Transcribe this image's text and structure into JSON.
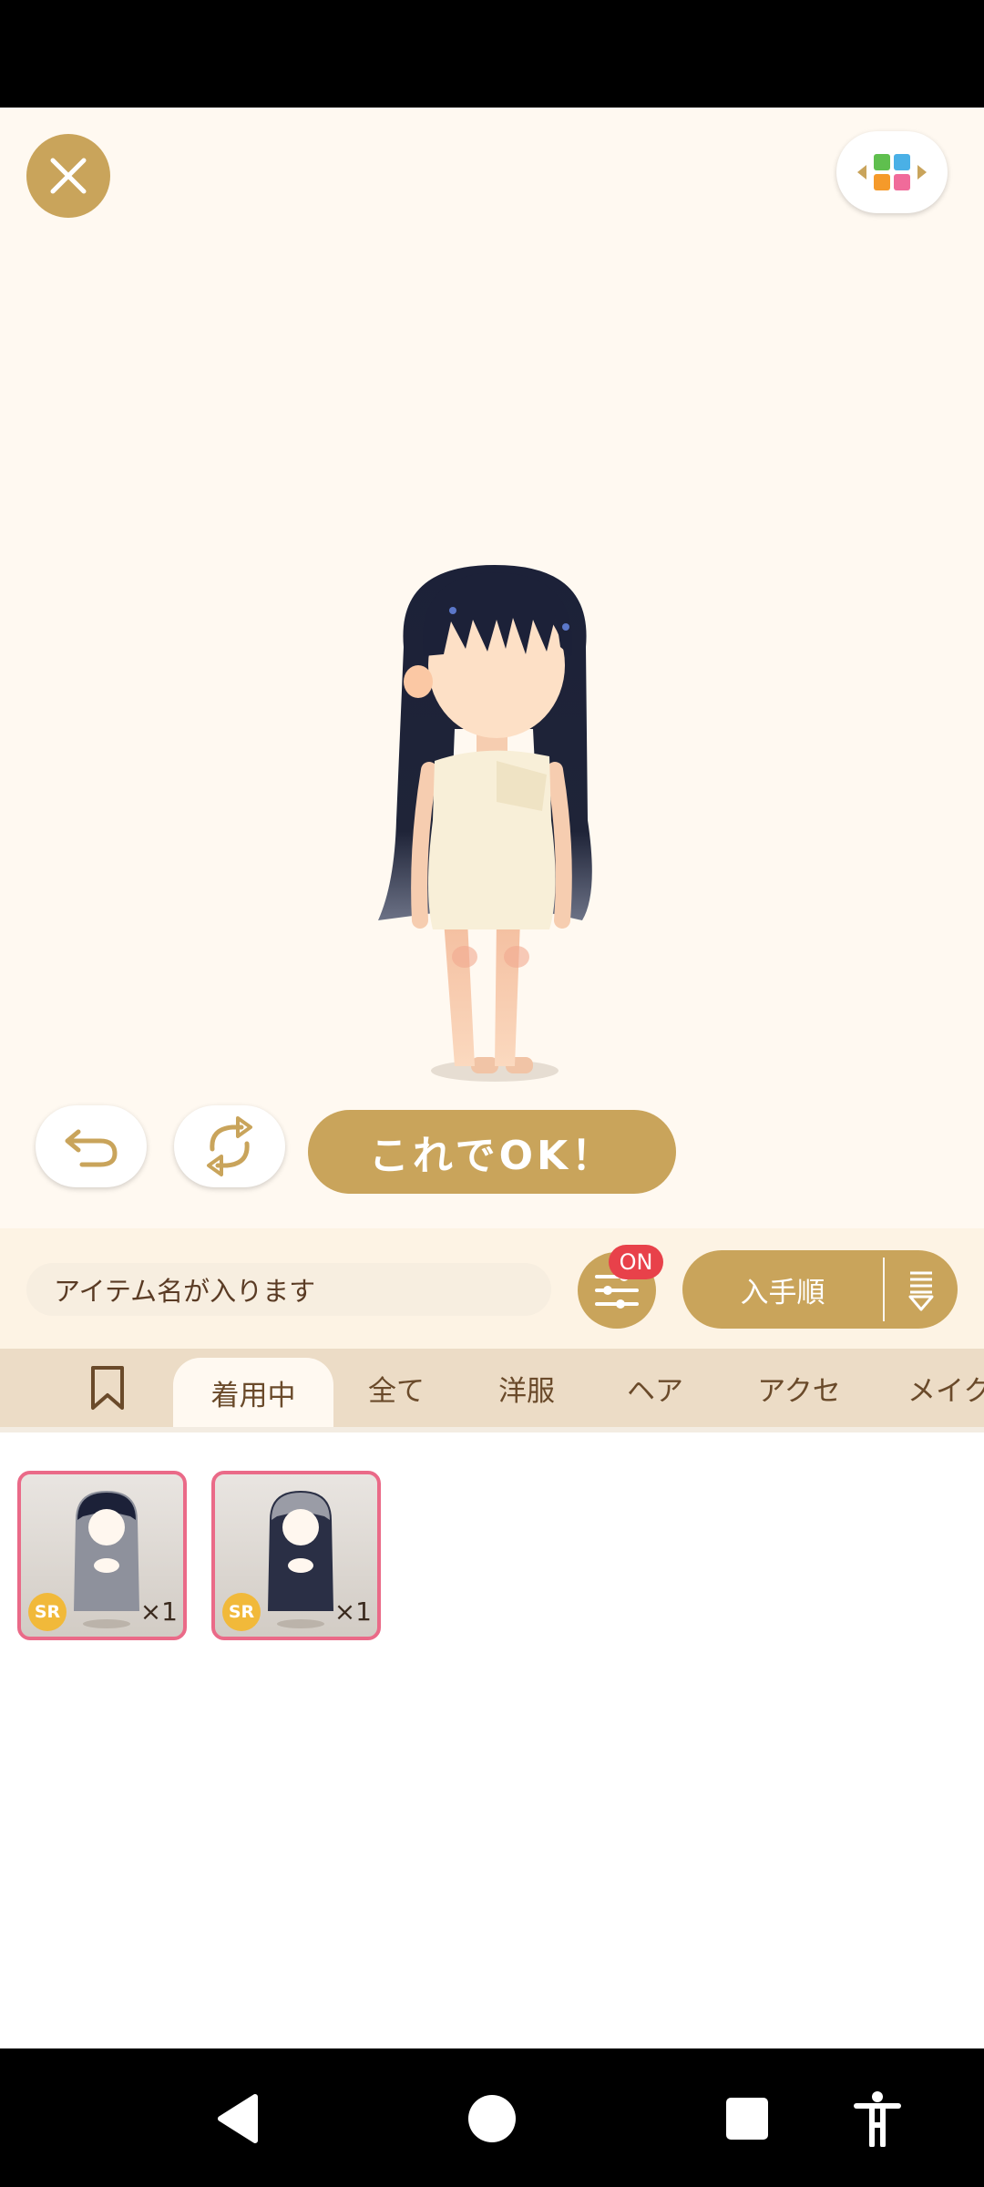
{
  "ok_button": "これでOK！",
  "search": {
    "placeholder": "アイテム名が入ります"
  },
  "filter": {
    "badge": "ON"
  },
  "sort": {
    "label": "入手順"
  },
  "tabs": [
    {
      "label": "着用中"
    },
    {
      "label": "全て"
    },
    {
      "label": "洋服"
    },
    {
      "label": "ヘア"
    },
    {
      "label": "アクセ"
    },
    {
      "label": "メイク"
    }
  ],
  "items": [
    {
      "rarity": "SR",
      "count": "×1"
    },
    {
      "rarity": "SR",
      "count": "×1"
    }
  ],
  "colors": {
    "accent": "#c9a45b",
    "background": "#fff9f1",
    "badge": "#e8414a",
    "card_border": "#ea6a88"
  },
  "icons": [
    "close-icon",
    "layout-switch-icon",
    "undo-icon",
    "random-icon",
    "filter-icon",
    "sort-icon",
    "bookmark-icon",
    "back-icon",
    "home-icon",
    "recents-icon",
    "accessibility-icon"
  ]
}
